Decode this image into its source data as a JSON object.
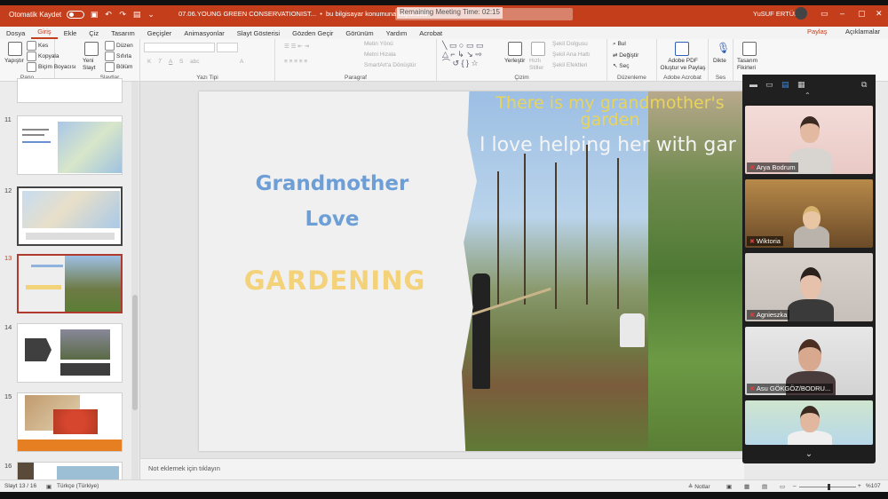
{
  "titlebar": {
    "autosave_label": "Otomatik Kaydet",
    "doc_title": "07.06.YOUNG GREEN CONSERVATIONIST...",
    "save_location": "bu bilgisayar konumuna kaydedildi",
    "meeting_timer": "Remaining Meeting Time: 02:15",
    "user_name": "YuSUF ERTÜRK",
    "brand_color": "#c43e1c"
  },
  "tabs": [
    "Dosya",
    "Giriş",
    "Ekle",
    "Çiz",
    "Tasarım",
    "Geçişler",
    "Animasyonlar",
    "Slayt Gösterisi",
    "Gözden Geçir",
    "Görünüm",
    "Yardım",
    "Acrobat"
  ],
  "active_tab": "Giriş",
  "share_label": "Paylaş",
  "comments_label": "Açıklamalar",
  "ribbon": {
    "pano": {
      "label": "Pano",
      "paste": "Yapıştır",
      "cut": "Kes",
      "copy": "Kopyala",
      "format_painter": "Biçim Boyacısı"
    },
    "slaytlar": {
      "label": "Slaytlar",
      "new_slide": "Yeni Slayt",
      "layout": "Düzen",
      "reset": "Sıfırla",
      "section": "Bölüm"
    },
    "yazi_tipi": {
      "label": "Yazı Tipi"
    },
    "paragraf": {
      "label": "Paragraf",
      "text_direction": "Metin Yönü",
      "align_text": "Metni Hizala",
      "smartart": "SmartArt'a Dönüştür"
    },
    "cizim": {
      "label": "Çizim",
      "arrange": "Yerleştir",
      "quick_styles": "Hızlı Stiller",
      "shape_fill": "Şekil Dolgusu",
      "shape_outline": "Şekil Ana Hattı",
      "shape_effects": "Şekil Efektleri"
    },
    "duzenleme": {
      "label": "Düzenleme",
      "find": "Bul",
      "replace": "Değiştir",
      "select": "Seç"
    },
    "adobe": {
      "label": "Adobe Acrobat",
      "create_pdf": "Adobe PDF Oluştur ve Paylaş"
    },
    "ses": {
      "label": "Ses",
      "dictate": "Dikte"
    },
    "tasarim": {
      "label": "Tasarım Fikirleri"
    }
  },
  "thumbnails": {
    "numbers": [
      "11",
      "12",
      "13",
      "14",
      "15",
      "16"
    ],
    "active": "13"
  },
  "slide": {
    "title": "Grandmother Love",
    "subtitle": "GARDENING",
    "caption_top": "There is my grandmother's garden",
    "caption_mid": "I love helping her with gar"
  },
  "notes_placeholder": "Not eklemek için tıklayın",
  "zoom_participants": [
    "Arya Bodrum",
    "Wiktoria",
    "Agnieszka",
    "Asu GÖKGÖZ/BODRU..."
  ],
  "status": {
    "slide_index": "Slayt 13 / 16",
    "language": "Türkçe (Türkiye)",
    "notes": "Notlar",
    "zoom_level": "%107"
  }
}
